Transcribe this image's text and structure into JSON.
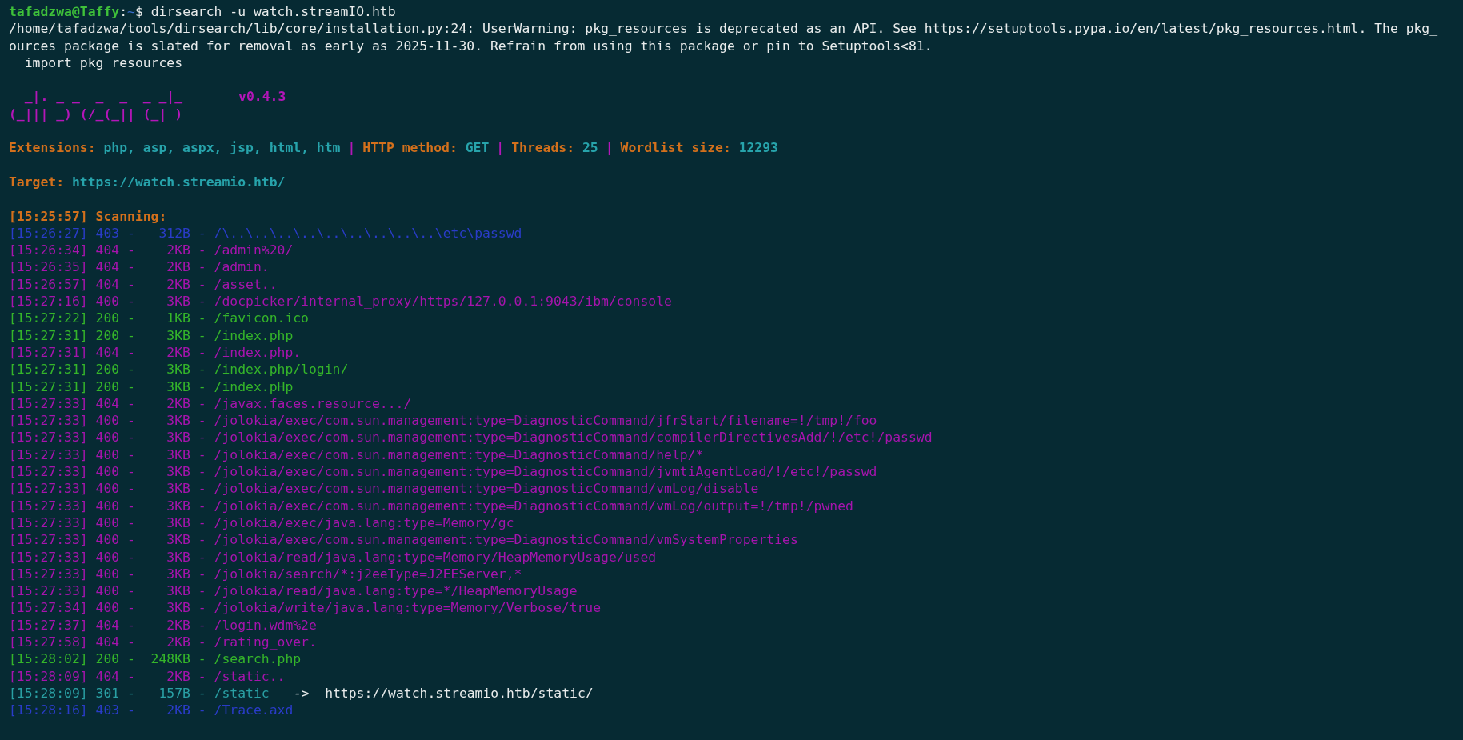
{
  "prompt": {
    "user": "tafadzwa@Taffy",
    "separator": ":",
    "path": "~",
    "symbol": "$",
    "command": "dirsearch -u watch.streamIO.htb"
  },
  "warning": [
    "/home/tafadzwa/tools/dirsearch/lib/core/installation.py:24: UserWarning: pkg_resources is deprecated as an API. See https://setuptools.pypa.io/en/latest/pkg_resources.html. The pkg_",
    "ources package is slated for removal as early as 2025-11-30. Refrain from using this package or pin to Setuptools<81.",
    "  import pkg_resources"
  ],
  "banner": {
    "art": [
      "  _|. _ _  _  _  _ _|_",
      "(_||| _) (/_(_|| (_| )"
    ],
    "version": "v0.4.3"
  },
  "settings": {
    "separator": "|",
    "fields": [
      {
        "label": "Extensions:",
        "value": "php, asp, aspx, jsp, html, htm"
      },
      {
        "label": "HTTP method:",
        "value": "GET"
      },
      {
        "label": "Threads:",
        "value": "25"
      },
      {
        "label": "Wordlist size:",
        "value": "12293"
      }
    ]
  },
  "target": {
    "label": "Target:",
    "url": "https://watch.streamio.htb/"
  },
  "scanning": "[15:25:57] Scanning:",
  "results": [
    {
      "text": "[15:26:27] 403 -   312B - /\\..\\..\\..\\..\\..\\..\\..\\..\\..\\etc\\passwd",
      "color": "#2a3cc8"
    },
    {
      "text": "[15:26:34] 404 -    2KB - /admin%20/",
      "color": "#a614ad"
    },
    {
      "text": "[15:26:35] 404 -    2KB - /admin.",
      "color": "#a614ad"
    },
    {
      "text": "[15:26:57] 404 -    2KB - /asset..",
      "color": "#a614ad"
    },
    {
      "text": "[15:27:16] 400 -    3KB - /docpicker/internal_proxy/https/127.0.0.1:9043/ibm/console",
      "color": "#a614ad"
    },
    {
      "text": "[15:27:22] 200 -    1KB - /favicon.ico",
      "color": "#35b52a"
    },
    {
      "text": "[15:27:31] 200 -    3KB - /index.php",
      "color": "#35b52a"
    },
    {
      "text": "[15:27:31] 404 -    2KB - /index.php.",
      "color": "#a614ad"
    },
    {
      "text": "[15:27:31] 200 -    3KB - /index.php/login/",
      "color": "#35b52a"
    },
    {
      "text": "[15:27:31] 200 -    3KB - /index.pHp",
      "color": "#35b52a"
    },
    {
      "text": "[15:27:33] 404 -    2KB - /javax.faces.resource.../",
      "color": "#a614ad"
    },
    {
      "text": "[15:27:33] 400 -    3KB - /jolokia/exec/com.sun.management:type=DiagnosticCommand/jfrStart/filename=!/tmp!/foo",
      "color": "#a614ad"
    },
    {
      "text": "[15:27:33] 400 -    3KB - /jolokia/exec/com.sun.management:type=DiagnosticCommand/compilerDirectivesAdd/!/etc!/passwd",
      "color": "#a614ad"
    },
    {
      "text": "[15:27:33] 400 -    3KB - /jolokia/exec/com.sun.management:type=DiagnosticCommand/help/*",
      "color": "#a614ad"
    },
    {
      "text": "[15:27:33] 400 -    3KB - /jolokia/exec/com.sun.management:type=DiagnosticCommand/jvmtiAgentLoad/!/etc!/passwd",
      "color": "#a614ad"
    },
    {
      "text": "[15:27:33] 400 -    3KB - /jolokia/exec/com.sun.management:type=DiagnosticCommand/vmLog/disable",
      "color": "#a614ad"
    },
    {
      "text": "[15:27:33] 400 -    3KB - /jolokia/exec/com.sun.management:type=DiagnosticCommand/vmLog/output=!/tmp!/pwned",
      "color": "#a614ad"
    },
    {
      "text": "[15:27:33] 400 -    3KB - /jolokia/exec/java.lang:type=Memory/gc",
      "color": "#a614ad"
    },
    {
      "text": "[15:27:33] 400 -    3KB - /jolokia/exec/com.sun.management:type=DiagnosticCommand/vmSystemProperties",
      "color": "#a614ad"
    },
    {
      "text": "[15:27:33] 400 -    3KB - /jolokia/read/java.lang:type=Memory/HeapMemoryUsage/used",
      "color": "#a614ad"
    },
    {
      "text": "[15:27:33] 400 -    3KB - /jolokia/search/*:j2eeType=J2EEServer,*",
      "color": "#a614ad"
    },
    {
      "text": "[15:27:33] 400 -    3KB - /jolokia/read/java.lang:type=*/HeapMemoryUsage",
      "color": "#a614ad"
    },
    {
      "text": "[15:27:34] 400 -    3KB - /jolokia/write/java.lang:type=Memory/Verbose/true",
      "color": "#a614ad"
    },
    {
      "text": "[15:27:37] 404 -    2KB - /login.wdm%2e",
      "color": "#a614ad"
    },
    {
      "text": "[15:27:58] 404 -    2KB - /rating_over.",
      "color": "#a614ad"
    },
    {
      "text": "[15:28:02] 200 -  248KB - /search.php",
      "color": "#35b52a"
    },
    {
      "text": "[15:28:09] 404 -    2KB - /static..",
      "color": "#a614ad"
    },
    {
      "text": "[15:28:09] 301 -   157B - /static",
      "color": "#2aa0a4",
      "redirect": "->  https://watch.streamio.htb/static/"
    },
    {
      "text": "[15:28:16] 403 -    2KB - /Trace.axd",
      "color": "#2a3cc8"
    }
  ]
}
